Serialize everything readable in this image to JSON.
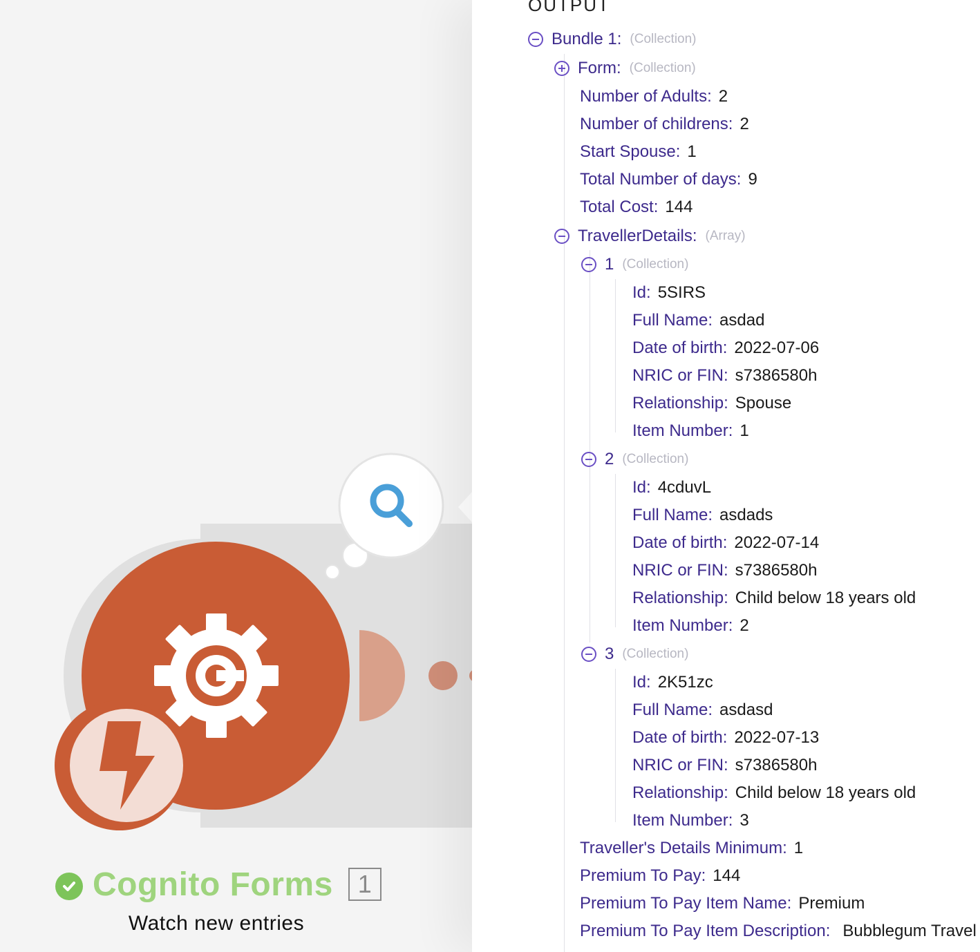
{
  "module": {
    "name": "Cognito Forms",
    "operation_count": "1",
    "subtitle": "Watch new entries",
    "status_icon": "check-icon",
    "trigger_icon": "lightning-icon",
    "search_icon": "magnifier-icon",
    "colors": {
      "accent": "#c95c35",
      "name_green": "#9fd47e",
      "check_green": "#7dc45a",
      "search_blue": "#4a9fd8"
    }
  },
  "output": {
    "header": "OUTPUT",
    "bundle": {
      "label": "Bundle 1:",
      "type": "(Collection)"
    },
    "form": {
      "label": "Form:",
      "type": "(Collection)"
    },
    "fields": [
      {
        "key": "Number of Adults",
        "value": "2"
      },
      {
        "key": "Number of childrens",
        "value": "2"
      },
      {
        "key": "Start Spouse",
        "value": "1"
      },
      {
        "key": "Total Number of days",
        "value": "9"
      },
      {
        "key": "Total Cost",
        "value": "144"
      }
    ],
    "traveller_details": {
      "label": "TravellerDetails:",
      "type": "(Array)"
    },
    "items": [
      {
        "index": "1",
        "type": "(Collection)",
        "fields": [
          {
            "key": "Id",
            "value": "5SIRS"
          },
          {
            "key": "Full Name",
            "value": "asdad"
          },
          {
            "key": "Date of birth",
            "value": "2022-07-06"
          },
          {
            "key": "NRIC or FIN",
            "value": "s7386580h"
          },
          {
            "key": "Relationship",
            "value": "Spouse"
          },
          {
            "key": "Item Number",
            "value": "1"
          }
        ]
      },
      {
        "index": "2",
        "type": "(Collection)",
        "fields": [
          {
            "key": "Id",
            "value": "4cduvL"
          },
          {
            "key": "Full Name",
            "value": "asdads"
          },
          {
            "key": "Date of birth",
            "value": "2022-07-14"
          },
          {
            "key": "NRIC or FIN",
            "value": "s7386580h"
          },
          {
            "key": "Relationship",
            "value": "Child below 18 years old"
          },
          {
            "key": "Item Number",
            "value": "2"
          }
        ]
      },
      {
        "index": "3",
        "type": "(Collection)",
        "fields": [
          {
            "key": "Id",
            "value": "2K51zc"
          },
          {
            "key": "Full Name",
            "value": "asdasd"
          },
          {
            "key": "Date of birth",
            "value": "2022-07-13"
          },
          {
            "key": "NRIC or FIN",
            "value": "s7386580h"
          },
          {
            "key": "Relationship",
            "value": "Child below 18 years old"
          },
          {
            "key": "Item Number",
            "value": "3"
          }
        ]
      }
    ],
    "trailing_fields": [
      {
        "key": "Traveller's Details Minimum",
        "value": "1"
      },
      {
        "key": "Premium To Pay",
        "value": "144"
      },
      {
        "key": "Premium To Pay Item Name",
        "value": "Premium"
      },
      {
        "key": "Premium To Pay Item Description",
        "value": "Bubblegum Travel"
      }
    ]
  }
}
